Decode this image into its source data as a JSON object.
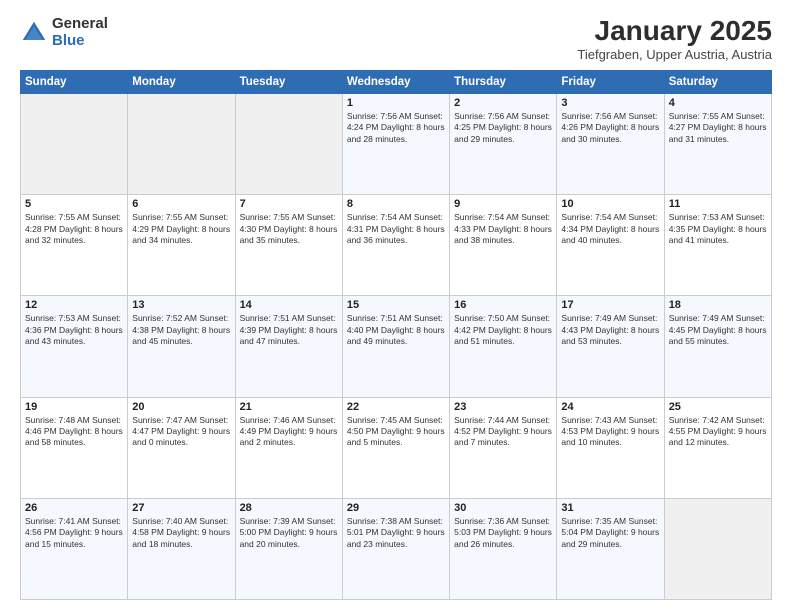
{
  "logo": {
    "general": "General",
    "blue": "Blue"
  },
  "header": {
    "title": "January 2025",
    "subtitle": "Tiefgraben, Upper Austria, Austria"
  },
  "weekdays": [
    "Sunday",
    "Monday",
    "Tuesday",
    "Wednesday",
    "Thursday",
    "Friday",
    "Saturday"
  ],
  "weeks": [
    [
      {
        "day": "",
        "content": ""
      },
      {
        "day": "",
        "content": ""
      },
      {
        "day": "",
        "content": ""
      },
      {
        "day": "1",
        "content": "Sunrise: 7:56 AM\nSunset: 4:24 PM\nDaylight: 8 hours\nand 28 minutes."
      },
      {
        "day": "2",
        "content": "Sunrise: 7:56 AM\nSunset: 4:25 PM\nDaylight: 8 hours\nand 29 minutes."
      },
      {
        "day": "3",
        "content": "Sunrise: 7:56 AM\nSunset: 4:26 PM\nDaylight: 8 hours\nand 30 minutes."
      },
      {
        "day": "4",
        "content": "Sunrise: 7:55 AM\nSunset: 4:27 PM\nDaylight: 8 hours\nand 31 minutes."
      }
    ],
    [
      {
        "day": "5",
        "content": "Sunrise: 7:55 AM\nSunset: 4:28 PM\nDaylight: 8 hours\nand 32 minutes."
      },
      {
        "day": "6",
        "content": "Sunrise: 7:55 AM\nSunset: 4:29 PM\nDaylight: 8 hours\nand 34 minutes."
      },
      {
        "day": "7",
        "content": "Sunrise: 7:55 AM\nSunset: 4:30 PM\nDaylight: 8 hours\nand 35 minutes."
      },
      {
        "day": "8",
        "content": "Sunrise: 7:54 AM\nSunset: 4:31 PM\nDaylight: 8 hours\nand 36 minutes."
      },
      {
        "day": "9",
        "content": "Sunrise: 7:54 AM\nSunset: 4:33 PM\nDaylight: 8 hours\nand 38 minutes."
      },
      {
        "day": "10",
        "content": "Sunrise: 7:54 AM\nSunset: 4:34 PM\nDaylight: 8 hours\nand 40 minutes."
      },
      {
        "day": "11",
        "content": "Sunrise: 7:53 AM\nSunset: 4:35 PM\nDaylight: 8 hours\nand 41 minutes."
      }
    ],
    [
      {
        "day": "12",
        "content": "Sunrise: 7:53 AM\nSunset: 4:36 PM\nDaylight: 8 hours\nand 43 minutes."
      },
      {
        "day": "13",
        "content": "Sunrise: 7:52 AM\nSunset: 4:38 PM\nDaylight: 8 hours\nand 45 minutes."
      },
      {
        "day": "14",
        "content": "Sunrise: 7:51 AM\nSunset: 4:39 PM\nDaylight: 8 hours\nand 47 minutes."
      },
      {
        "day": "15",
        "content": "Sunrise: 7:51 AM\nSunset: 4:40 PM\nDaylight: 8 hours\nand 49 minutes."
      },
      {
        "day": "16",
        "content": "Sunrise: 7:50 AM\nSunset: 4:42 PM\nDaylight: 8 hours\nand 51 minutes."
      },
      {
        "day": "17",
        "content": "Sunrise: 7:49 AM\nSunset: 4:43 PM\nDaylight: 8 hours\nand 53 minutes."
      },
      {
        "day": "18",
        "content": "Sunrise: 7:49 AM\nSunset: 4:45 PM\nDaylight: 8 hours\nand 55 minutes."
      }
    ],
    [
      {
        "day": "19",
        "content": "Sunrise: 7:48 AM\nSunset: 4:46 PM\nDaylight: 8 hours\nand 58 minutes."
      },
      {
        "day": "20",
        "content": "Sunrise: 7:47 AM\nSunset: 4:47 PM\nDaylight: 9 hours\nand 0 minutes."
      },
      {
        "day": "21",
        "content": "Sunrise: 7:46 AM\nSunset: 4:49 PM\nDaylight: 9 hours\nand 2 minutes."
      },
      {
        "day": "22",
        "content": "Sunrise: 7:45 AM\nSunset: 4:50 PM\nDaylight: 9 hours\nand 5 minutes."
      },
      {
        "day": "23",
        "content": "Sunrise: 7:44 AM\nSunset: 4:52 PM\nDaylight: 9 hours\nand 7 minutes."
      },
      {
        "day": "24",
        "content": "Sunrise: 7:43 AM\nSunset: 4:53 PM\nDaylight: 9 hours\nand 10 minutes."
      },
      {
        "day": "25",
        "content": "Sunrise: 7:42 AM\nSunset: 4:55 PM\nDaylight: 9 hours\nand 12 minutes."
      }
    ],
    [
      {
        "day": "26",
        "content": "Sunrise: 7:41 AM\nSunset: 4:56 PM\nDaylight: 9 hours\nand 15 minutes."
      },
      {
        "day": "27",
        "content": "Sunrise: 7:40 AM\nSunset: 4:58 PM\nDaylight: 9 hours\nand 18 minutes."
      },
      {
        "day": "28",
        "content": "Sunrise: 7:39 AM\nSunset: 5:00 PM\nDaylight: 9 hours\nand 20 minutes."
      },
      {
        "day": "29",
        "content": "Sunrise: 7:38 AM\nSunset: 5:01 PM\nDaylight: 9 hours\nand 23 minutes."
      },
      {
        "day": "30",
        "content": "Sunrise: 7:36 AM\nSunset: 5:03 PM\nDaylight: 9 hours\nand 26 minutes."
      },
      {
        "day": "31",
        "content": "Sunrise: 7:35 AM\nSunset: 5:04 PM\nDaylight: 9 hours\nand 29 minutes."
      },
      {
        "day": "",
        "content": ""
      }
    ]
  ]
}
